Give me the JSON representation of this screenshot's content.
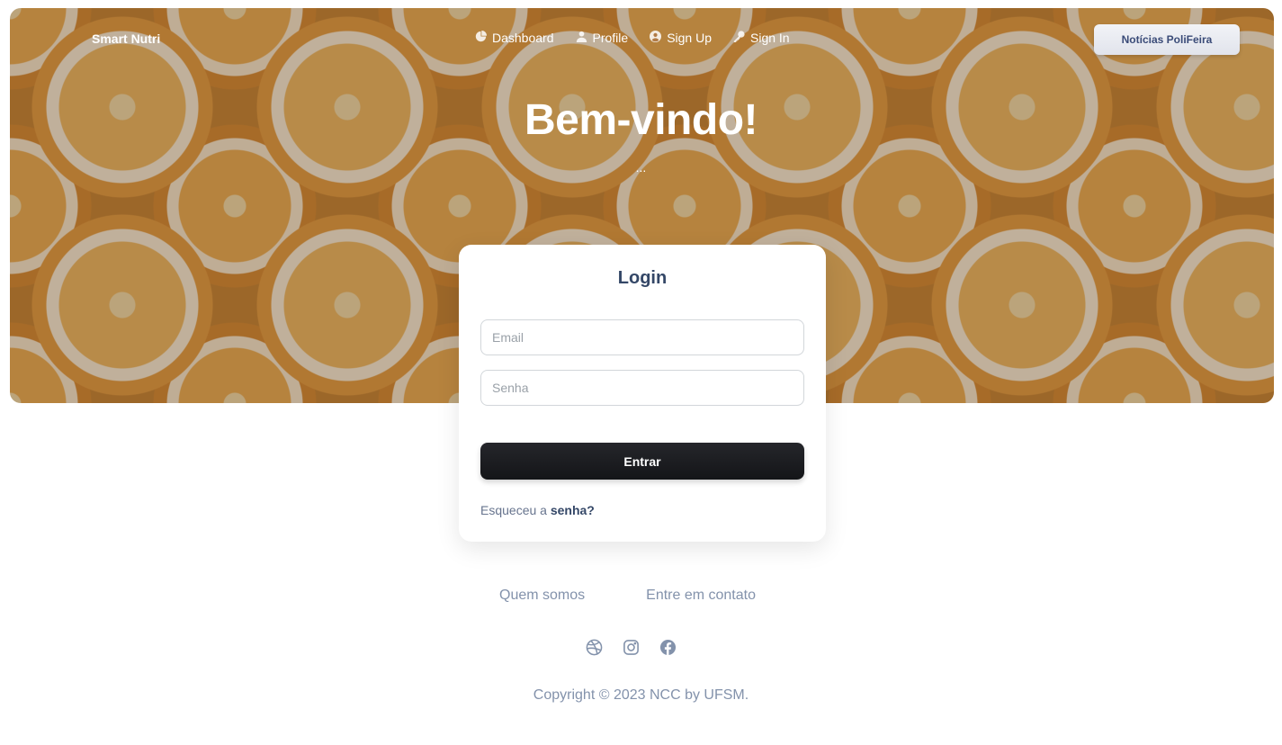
{
  "navbar": {
    "brand": "Smart Nutri",
    "links": [
      {
        "label": "Dashboard",
        "icon": "pie-chart-icon"
      },
      {
        "label": "Profile",
        "icon": "user-icon"
      },
      {
        "label": "Sign Up",
        "icon": "user-circle-icon"
      },
      {
        "label": "Sign In",
        "icon": "key-icon"
      }
    ],
    "news_button": "Notícias PoliFeira"
  },
  "hero": {
    "title": "Bem-vindo!",
    "subtitle": "..."
  },
  "login": {
    "title": "Login",
    "email_placeholder": "Email",
    "email_value": "",
    "password_placeholder": "Senha",
    "password_value": "",
    "submit_label": "Entrar",
    "forgot_prefix": "Esqueceu a ",
    "forgot_link": "senha?"
  },
  "footer": {
    "links": [
      "Quem somos",
      "Entre em contato"
    ],
    "socials": [
      "dribbble-icon",
      "instagram-icon",
      "facebook-icon"
    ],
    "copyright": "Copyright © 2023 NCC by UFSM."
  },
  "colors": {
    "primary_text": "#344767",
    "muted_text": "#8392ab",
    "button_dark": "#1c1d21",
    "hero_accent": "#e79a3b"
  }
}
